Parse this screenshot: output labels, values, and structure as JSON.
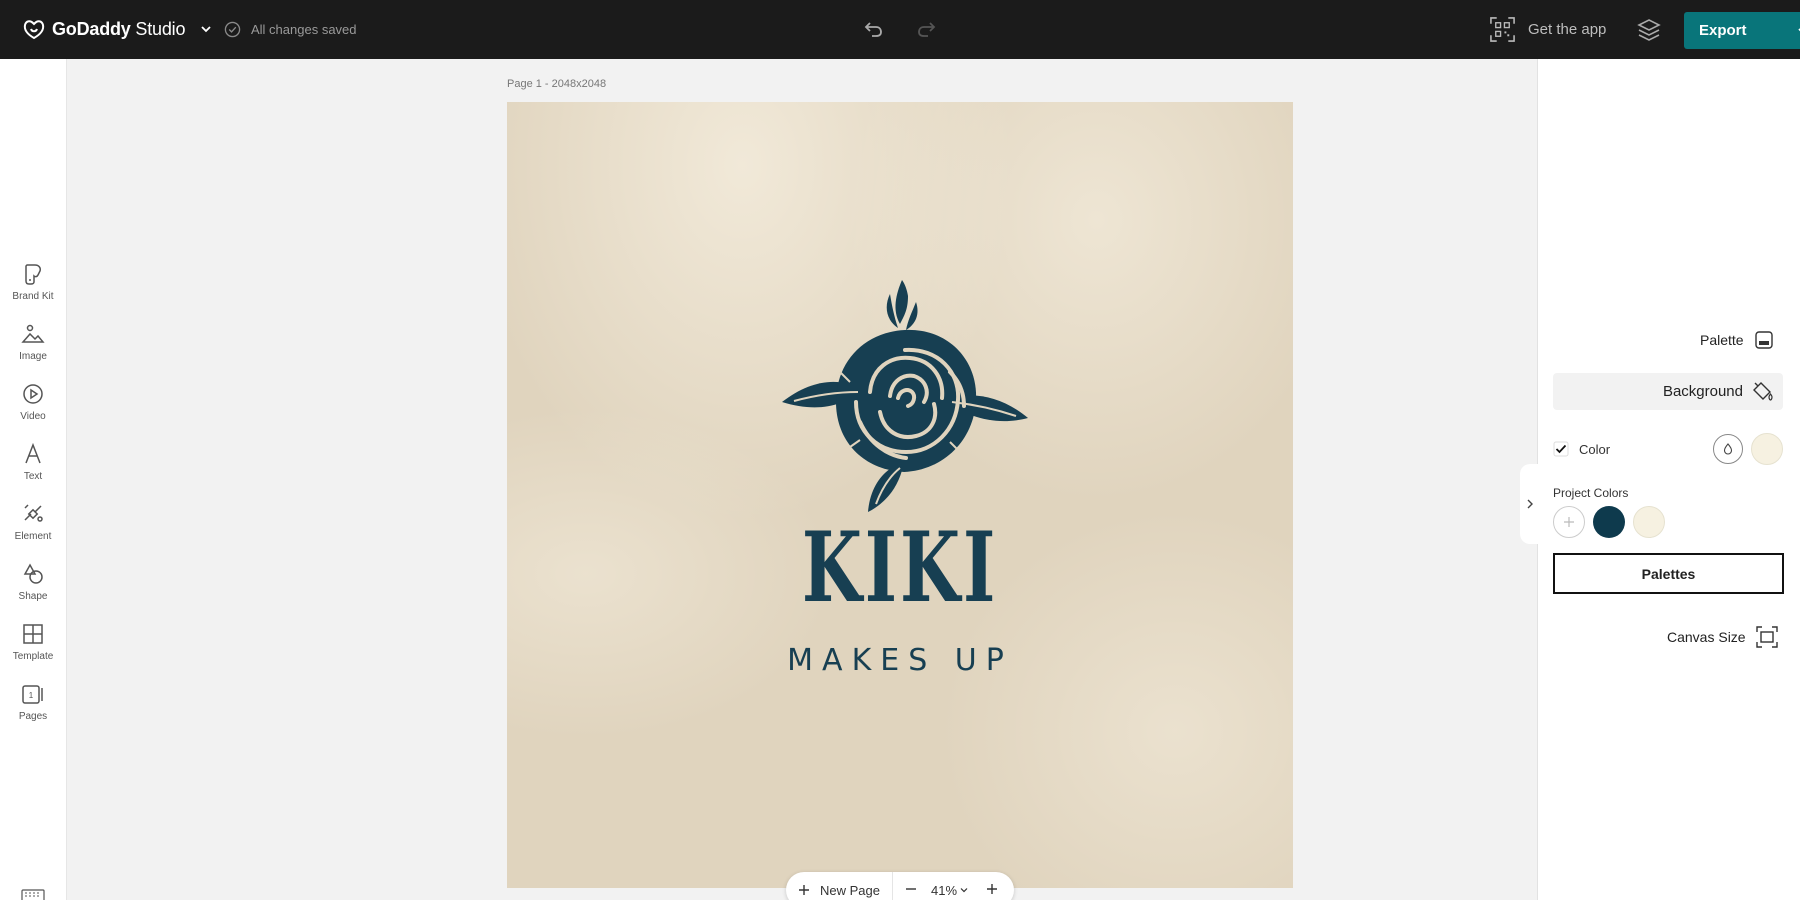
{
  "app": {
    "brand_name_bold": "GoDaddy",
    "brand_name_light": " Studio",
    "save_status": "All changes saved",
    "get_app_label": "Get the app",
    "export_label": "Export"
  },
  "sidebar": {
    "items": [
      {
        "label": "Brand Kit",
        "icon": "brand-kit-icon"
      },
      {
        "label": "Image",
        "icon": "image-icon"
      },
      {
        "label": "Video",
        "icon": "video-icon"
      },
      {
        "label": "Text",
        "icon": "text-icon"
      },
      {
        "label": "Element",
        "icon": "element-icon"
      },
      {
        "label": "Shape",
        "icon": "shape-icon"
      },
      {
        "label": "Template",
        "icon": "template-icon"
      },
      {
        "label": "Pages",
        "icon": "pages-icon"
      }
    ]
  },
  "canvas": {
    "page_label": "Page 1 - 2048x2048",
    "headline": "KIKI",
    "tagline": "MAKES UP",
    "background_color": "#e0d4be",
    "ink_color": "#173f52"
  },
  "pagebar": {
    "new_page_label": "New Page",
    "zoom": "41%"
  },
  "right_panel": {
    "palette_label": "Palette",
    "background_label": "Background",
    "color_label": "Color",
    "color_checked": true,
    "current_color": "#f6f1e1",
    "project_colors_label": "Project Colors",
    "project_colors": [
      "#0e3a4d",
      "#f6f1e1"
    ],
    "palettes_button": "Palettes",
    "canvas_size_label": "Canvas Size"
  },
  "colors": {
    "topbar": "#1b1b1b",
    "accent": "#09757a"
  }
}
